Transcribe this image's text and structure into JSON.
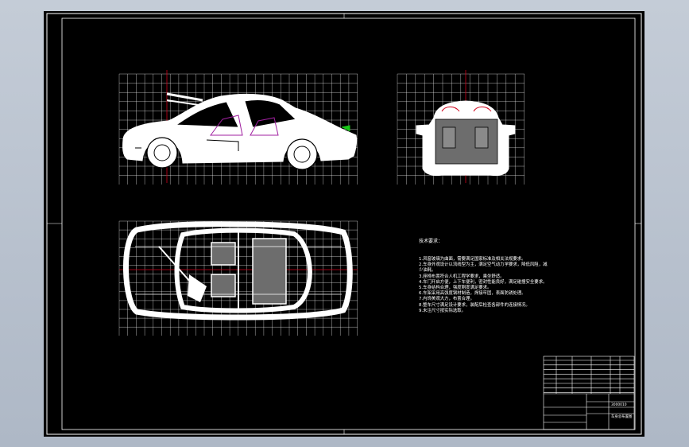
{
  "drawing": {
    "tech_requirements_title": "技术要求：",
    "tech_requirements": [
      "1.风窗玻璃为曲面，需要满足国家标准及相关法规要求。",
      "2.车身外观设计以流线型为主，满足空气动力学要求，降低风阻，减少油耗。",
      "3.座椅布置符合人机工程学要求，乘坐舒适。",
      "4.车门开启方便，上下车便利，密封性能良好，满足碰撞安全要求。",
      "5.车身结构合理，强度刚度满足要求。",
      "6.车架采用高强度钢材制造，焊接牢固，表面防锈处理。",
      "7.内饰美观大方，布置合理。",
      "8.整车尺寸满足设计要求，装配后检查各部件的连接情况。",
      "9.未注尺寸按实际选取。"
    ],
    "drawing_number": "3000010",
    "title_block_name": "车身总布置图"
  },
  "colors": {
    "background": "#000000",
    "lines": "#ffffff",
    "centerline": "#d0021b",
    "accent": "#a020a0",
    "green": "#19c919"
  }
}
